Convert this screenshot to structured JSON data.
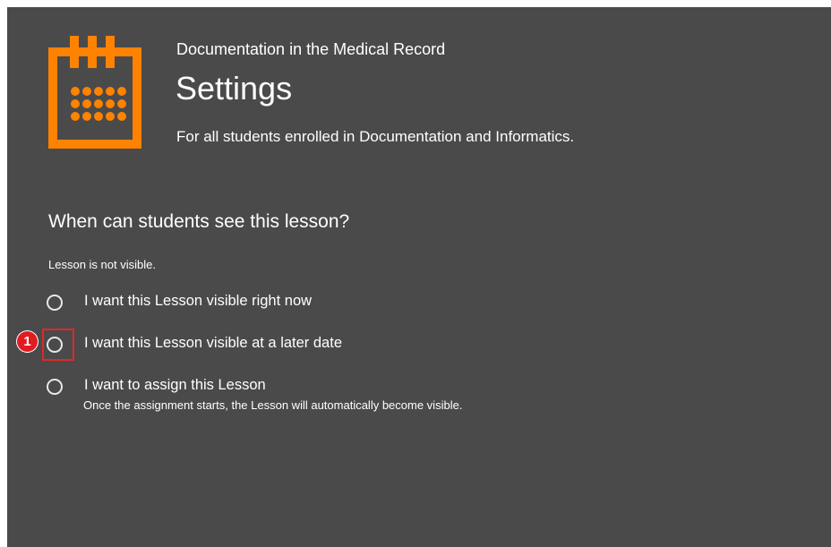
{
  "header": {
    "icon": "calendar-icon",
    "course_title": "Documentation in the Medical Record",
    "page_title": "Settings",
    "subtitle": "For all students enrolled in Documentation and Informatics."
  },
  "visibility": {
    "heading": "When can students see this lesson?",
    "status": "Lesson is not visible.",
    "options": [
      {
        "label": "I want this Lesson visible right now",
        "selected": false
      },
      {
        "label": "I want this Lesson visible at a later date",
        "selected": false
      },
      {
        "label": "I want to assign this Lesson",
        "note": "Once the assignment starts, the Lesson will automatically become visible.",
        "selected": false
      }
    ]
  },
  "annotation": {
    "step_number": "1"
  },
  "colors": {
    "panel_background": "#4a4a4a",
    "accent_orange": "#ff8200",
    "highlight_red": "#e0272b",
    "text": "#ffffff"
  }
}
